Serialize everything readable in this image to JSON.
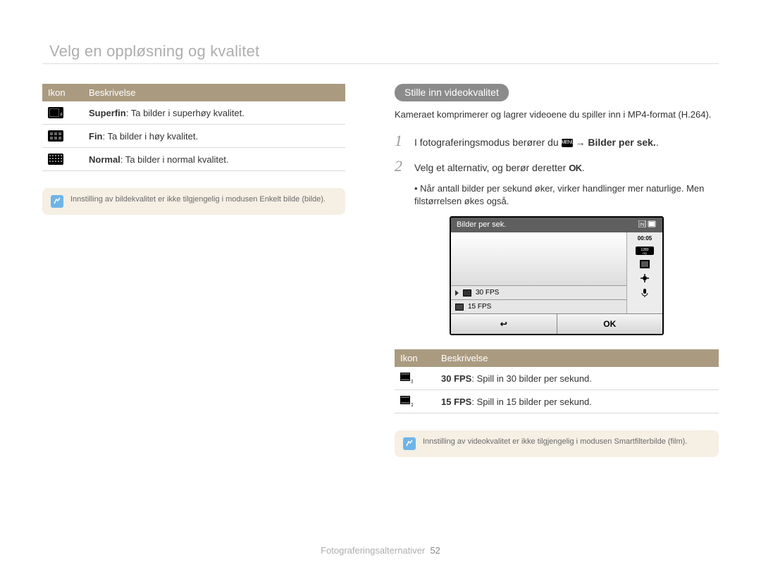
{
  "title": "Velg en oppløsning og kvalitet",
  "leftTable": {
    "headers": [
      "Ikon",
      "Beskrivelse"
    ],
    "rows": [
      {
        "iconLabel": "SF",
        "strong": "Superfin",
        "rest": ": Ta bilder i superhøy kvalitet."
      },
      {
        "iconLabel": "F",
        "strong": "Fin",
        "rest": ": Ta bilder i høy kvalitet."
      },
      {
        "iconLabel": "N",
        "strong": "Normal",
        "rest": ": Ta bilder i normal kvalitet."
      }
    ]
  },
  "leftNote": "Innstilling av bildekvalitet er ikke tilgjengelig i modusen Enkelt bilde (bilde).",
  "heading": "Stille inn videokvalitet",
  "intro": "Kameraet komprimerer og lagrer videoene du spiller inn i MP4-format (H.264).",
  "steps": {
    "one_pre": "I fotograferingsmodus berører du ",
    "one_menu": "MENU",
    "one_arrow": " → ",
    "one_strong": "Bilder per sek.",
    "one_period": ".",
    "two_pre": "Velg et alternativ, og berør deretter ",
    "two_ok": "OK",
    "two_period": "."
  },
  "bullet": "Når antall bilder per sekund øker, virker handlinger mer naturlige. Men filstørrelsen økes også.",
  "screen": {
    "title": "Bilder per sek.",
    "time": "00:05",
    "badge": "1280 HQ",
    "opt30": "30 FPS",
    "opt15": "15 FPS",
    "back": "↩",
    "ok": "OK"
  },
  "rightTable": {
    "headers": [
      "Ikon",
      "Beskrivelse"
    ],
    "rows": [
      {
        "iconLabel": "30",
        "strong": "30 FPS",
        "rest": ": Spill in 30 bilder per sekund."
      },
      {
        "iconLabel": "15",
        "strong": "15 FPS",
        "rest": ": Spill in 15 bilder per sekund."
      }
    ]
  },
  "rightNote": "Innstilling av videokvalitet er ikke tilgjengelig i modusen Smartfilterbilde (film).",
  "footer": {
    "section": "Fotograferingsalternativer",
    "page": "52"
  }
}
